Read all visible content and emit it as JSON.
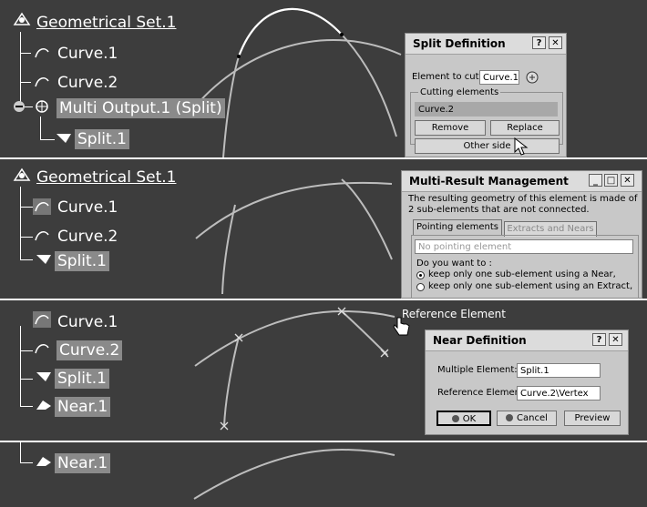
{
  "panel1": {
    "tree": {
      "root": "Geometrical Set.1",
      "items": [
        "Curve.1",
        "Curve.2",
        "Multi Output.1 (Split)",
        "Split.1"
      ]
    },
    "split_dialog": {
      "title": "Split Definition",
      "help_glyph": "?",
      "close_glyph": "✕",
      "element_to_cut_label": "Element to cut:",
      "element_to_cut_value": "Curve.1",
      "cutting_elements_label": "Cutting elements",
      "cutting_elements_list": [
        "Curve.2"
      ],
      "remove_label": "Remove",
      "replace_label": "Replace",
      "other_side_label": "Other side"
    }
  },
  "panel2": {
    "tree": {
      "root": "Geometrical Set.1",
      "items": [
        "Curve.1",
        "Curve.2",
        "Split.1"
      ]
    },
    "mrm_dialog": {
      "title": "Multi-Result  Management",
      "message": [
        "The resulting geometry of this element is made of",
        "2 sub-elements that are not connected."
      ],
      "tab_pointing": "Pointing elements",
      "tab_extracts": "Extracts and Nears",
      "pointing_placeholder": "No pointing element",
      "question": "Do you want to :",
      "options": [
        "keep only one sub-element using a Near,",
        "keep only one sub-element using an Extract,"
      ]
    }
  },
  "panel3": {
    "tree": {
      "items": [
        "Curve.1",
        "Curve.2",
        "Split.1",
        "Near.1"
      ]
    },
    "reference_tooltip": "Reference Element",
    "near_dialog": {
      "title": "Near Definition",
      "help_glyph": "?",
      "close_glyph": "✕",
      "multiple_element_label": "Multiple Element:",
      "multiple_element_value": "Split.1",
      "reference_element_label": "Reference Element:",
      "reference_element_value": "Curve.2\\Vertex",
      "ok_label": "OK",
      "cancel_label": "Cancel",
      "preview_label": "Preview"
    }
  },
  "panel4": {
    "tree": {
      "items": [
        "Near.1"
      ]
    }
  },
  "colors": {
    "viewport_bg": "#3d3d3d",
    "tree_text": "#ffffff",
    "selection_bg": "#8a8a8a",
    "dialog_bg": "#c8c8c8"
  },
  "icons": [
    "geometrical-set-icon",
    "curve-icon",
    "multi-output-icon",
    "split-icon",
    "near-icon",
    "selector-icon",
    "hand-cursor-icon",
    "arrow-cursor-icon"
  ]
}
